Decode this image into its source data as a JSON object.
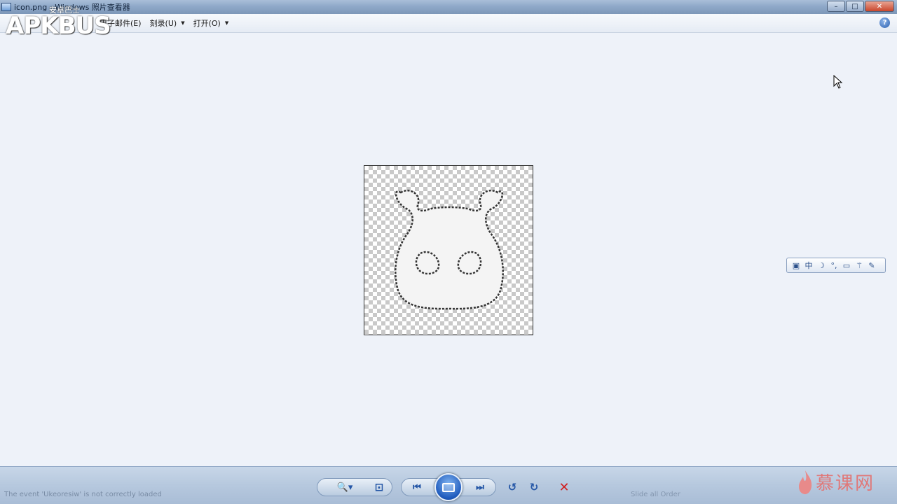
{
  "window": {
    "title": "icon.png - Windows 照片查看器",
    "controls": {
      "minimize": "–",
      "maximize": "□",
      "close": "✕"
    }
  },
  "watermark": {
    "brand": "APKBUS",
    "sub": "安卓巴士"
  },
  "menu": {
    "items": [
      {
        "label": "电子邮件(E)"
      },
      {
        "label": "刻录(U)",
        "has_dropdown": true
      },
      {
        "label": "打开(O)",
        "has_dropdown": true
      }
    ],
    "help_label": "?"
  },
  "ime_toolbar": {
    "icons": [
      "▣",
      "中",
      "☽",
      "°,",
      "▭",
      "⚚",
      "✎"
    ]
  },
  "bottom_bar": {
    "status_text": "The event 'Ukeoresiw' is not correctly loaded",
    "slideshow_text": "Slide all Order",
    "controls": {
      "zoom": "🔍▾",
      "fit": "⊡",
      "prev": "⏮",
      "next": "⏭",
      "rotate_ccw": "↺",
      "rotate_cw": "↻",
      "delete": "✕"
    }
  },
  "logo": {
    "text": "慕课网"
  },
  "colors": {
    "accent": "#2456a6",
    "delete": "#d02020",
    "background": "#eef2f9"
  }
}
